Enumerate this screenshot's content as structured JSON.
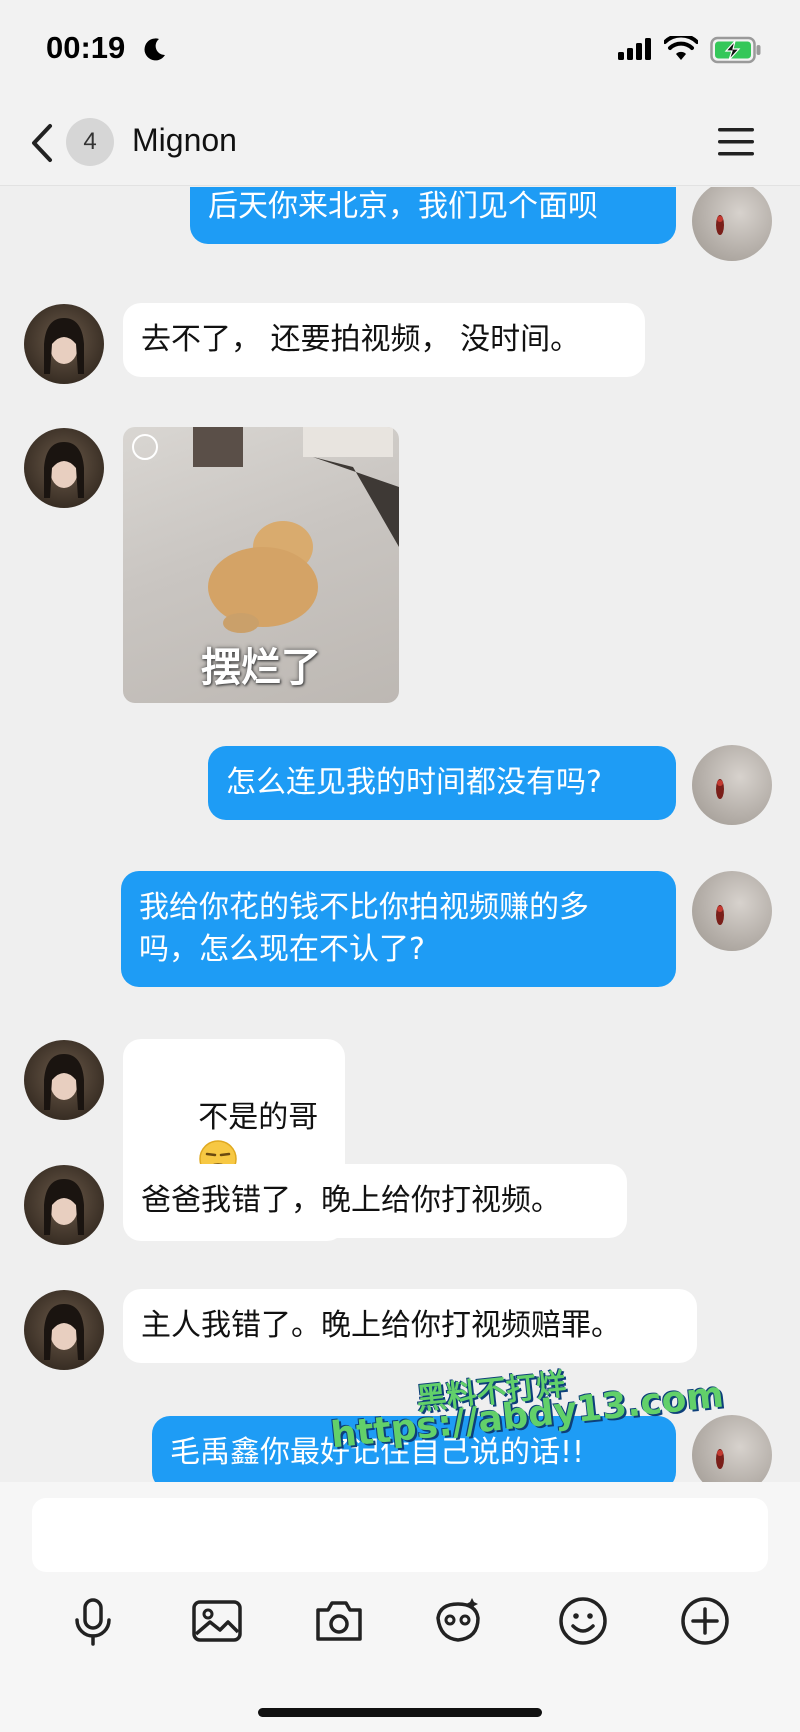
{
  "status_bar": {
    "time": "00:19",
    "icons": [
      "moon-icon",
      "signal-icon",
      "wifi-icon",
      "battery-charging-icon"
    ],
    "battery_color": "#34c759"
  },
  "header": {
    "unread_count": "4",
    "contact_name": "Mignon"
  },
  "messages": [
    {
      "direction": "out",
      "text": "后天你来北京，我们见个面呗"
    },
    {
      "direction": "in",
      "text": "去不了， 还要拍视频， 没时间。"
    },
    {
      "direction": "in",
      "type": "sticker",
      "caption": "摆烂了"
    },
    {
      "direction": "out",
      "text": "怎么连见我的时间都没有吗?"
    },
    {
      "direction": "out",
      "text": "我给你花的钱不比你拍视频赚的多\n吗，怎么现在不认了?"
    },
    {
      "direction": "in",
      "text": "不是的哥",
      "emoji": "smirk-emoji"
    },
    {
      "direction": "in",
      "text": "爸爸我错了，晚上给你打视频。"
    },
    {
      "direction": "in",
      "text": "主人我错了。晚上给你打视频赔罪。"
    },
    {
      "direction": "out",
      "text": "毛禹鑫你最好记住自己说的话!!"
    }
  ],
  "watermark": {
    "line1": "黑料不打烊",
    "line2": "https://abdy13.com"
  },
  "input": {
    "placeholder": ""
  },
  "toolbar": [
    "microphone-icon",
    "image-icon",
    "camera-icon",
    "sticker-icon",
    "emoji-icon",
    "plus-icon"
  ],
  "colors": {
    "outgoing_bubble": "#1e9cf5",
    "incoming_bubble": "#ffffff",
    "background": "#efefef"
  }
}
